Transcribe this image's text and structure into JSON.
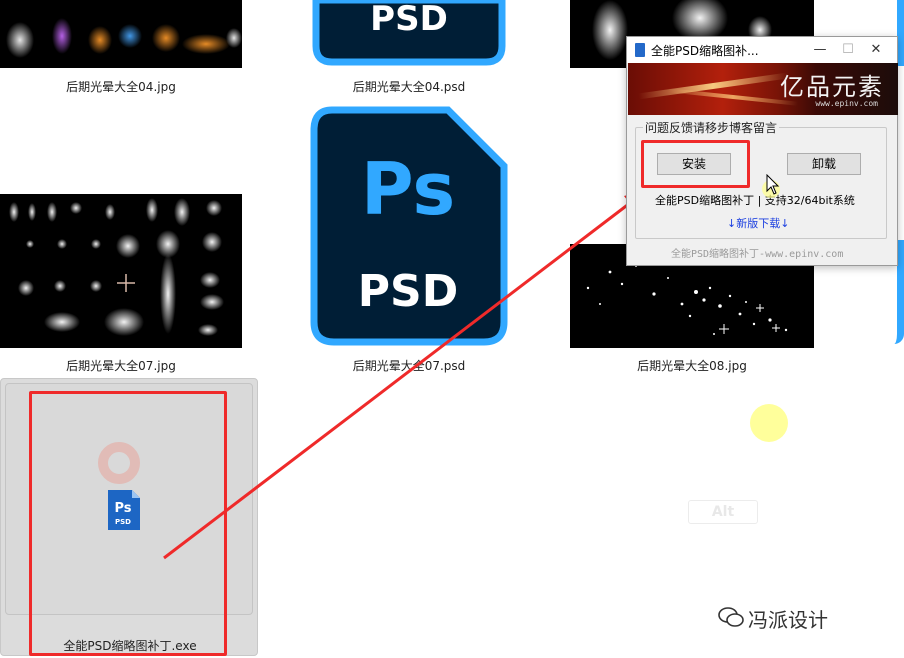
{
  "files": [
    {
      "name": "后期光晕大全04.jpg"
    },
    {
      "name": "后期光晕大全04.psd"
    },
    {
      "name": "后期光晕大全07.jpg"
    },
    {
      "name": "后期光晕大全07.psd"
    },
    {
      "name": "后期光晕大全08.jpg"
    },
    {
      "name": "全能PSD缩略图补丁.exe"
    }
  ],
  "ps_icon": {
    "big_text": "Ps",
    "psd_text": "PSD"
  },
  "dialog": {
    "title": "全能PSD缩略图补...",
    "minimize": "—",
    "maximize": "☐",
    "close": "✕",
    "banner_logo": "亿品元素",
    "banner_url": "www.epinv.com",
    "group_label": "问题反馈请移步博客留言",
    "install_label": "安装",
    "uninstall_label": "卸载",
    "support_text": "全能PSD缩略图补丁 | 支持32/64bit系统",
    "download_link": "↓新版下载↓",
    "footer": "全能PSD缩略图补丁-www.epinv.com"
  },
  "alt_key": "Alt",
  "watermark": "冯派设计",
  "colors": {
    "annotation_red": "#ef2a2a",
    "ps_blue": "#31a8ff",
    "ps_bg": "#001e36"
  }
}
